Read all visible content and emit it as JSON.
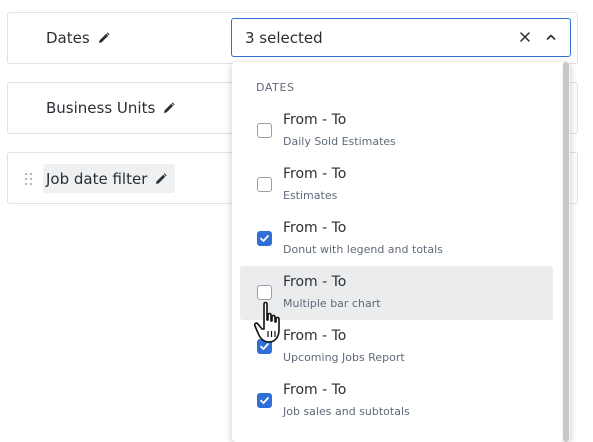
{
  "filters": [
    {
      "label": "Dates"
    },
    {
      "label": "Business Units"
    },
    {
      "label": "Job date filter"
    }
  ],
  "select": {
    "value": "3 selected"
  },
  "dropdown": {
    "heading": "DATES",
    "options": [
      {
        "title": "From - To",
        "subtitle": "Daily Sold Estimates",
        "checked": false
      },
      {
        "title": "From - To",
        "subtitle": "Estimates",
        "checked": false
      },
      {
        "title": "From - To",
        "subtitle": "Donut with legend and totals",
        "checked": true
      },
      {
        "title": "From - To",
        "subtitle": "Multiple bar chart",
        "checked": false
      },
      {
        "title": "From - To",
        "subtitle": "Upcoming Jobs Report",
        "checked": true
      },
      {
        "title": "From - To",
        "subtitle": "Job sales and subtotals",
        "checked": true
      }
    ]
  },
  "colors": {
    "accent": "#2f6fd6",
    "hover": "#ebeced",
    "border": "#e1e3e6"
  }
}
